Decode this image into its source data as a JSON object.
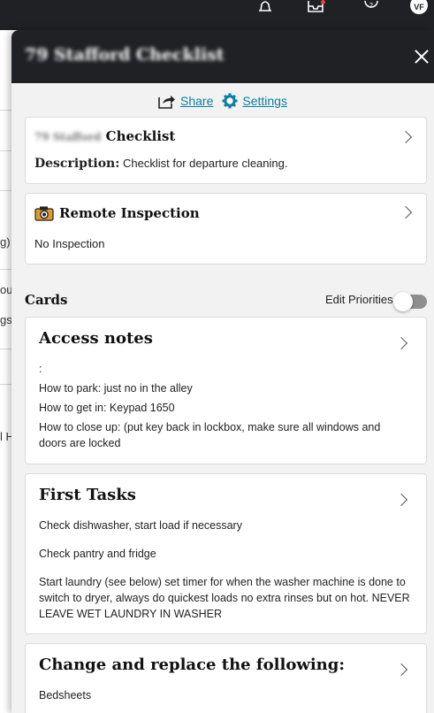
{
  "topbar": {
    "icons": [
      "bell-icon",
      "inbox-icon",
      "help-icon"
    ],
    "avatar_initials": "VF"
  },
  "background_page": {
    "row_fragments": [
      "g)",
      "ou",
      "gst",
      "l H"
    ]
  },
  "panel": {
    "title": "79 Stafford Checklist",
    "close_icon": "close-icon",
    "share_label": "Share",
    "settings_label": "Settings",
    "checklist_card": {
      "name_prefix": "79 Stafford",
      "name_suffix": "Checklist",
      "description_label": "Description:",
      "description_value": "Checklist for departure cleaning."
    },
    "inspection_card": {
      "title": "Remote Inspection",
      "value": "No Inspection"
    },
    "cards_label": "Cards",
    "edit_priorities_label": "Edit Priorities",
    "cards": [
      {
        "title": "Access notes",
        "lines": [
          ":",
          " How to park: just no in the alley",
          " How to get in: Keypad 1650",
          " How to close up: (put key back in lockbox, make sure all windows and doors are locked"
        ]
      },
      {
        "title": "First Tasks",
        "lines": [
          "Check dishwasher, start load if necessary",
          "Check pantry and fridge",
          "Start laundry (see below) set timer for when the washer machine is done to switch to dryer, always do quickest loads no extra rinses but on hot. NEVER LEAVE WET LAUNDRY IN WASHER"
        ]
      },
      {
        "title": "Change and replace the following:",
        "lines": [
          "Bedsheets"
        ]
      }
    ]
  },
  "colors": {
    "header_bg": "#1f2124",
    "panel_bg": "#f2f2f2",
    "link": "#0a7fa0",
    "toggle_off": "#8f8f8f"
  }
}
